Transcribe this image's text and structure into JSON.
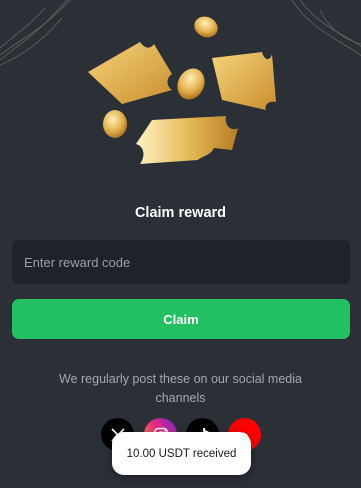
{
  "reward": {
    "title": "Claim reward",
    "input_placeholder": "Enter reward code",
    "input_value": "",
    "claim_label": "Claim"
  },
  "social": {
    "text": "We regularly post these on our social media channels",
    "links": [
      {
        "icon": "x-logo-icon"
      },
      {
        "icon": "instagram-logo-icon"
      },
      {
        "icon": "tiktok-logo-icon"
      },
      {
        "icon": "youtube-logo-icon"
      }
    ]
  },
  "toast": {
    "message": "10.00 USDT received"
  },
  "colors": {
    "background": "#2b2f36",
    "input_background": "#1e222a",
    "accent_green": "#22c060",
    "gold": "#e0b24a"
  }
}
